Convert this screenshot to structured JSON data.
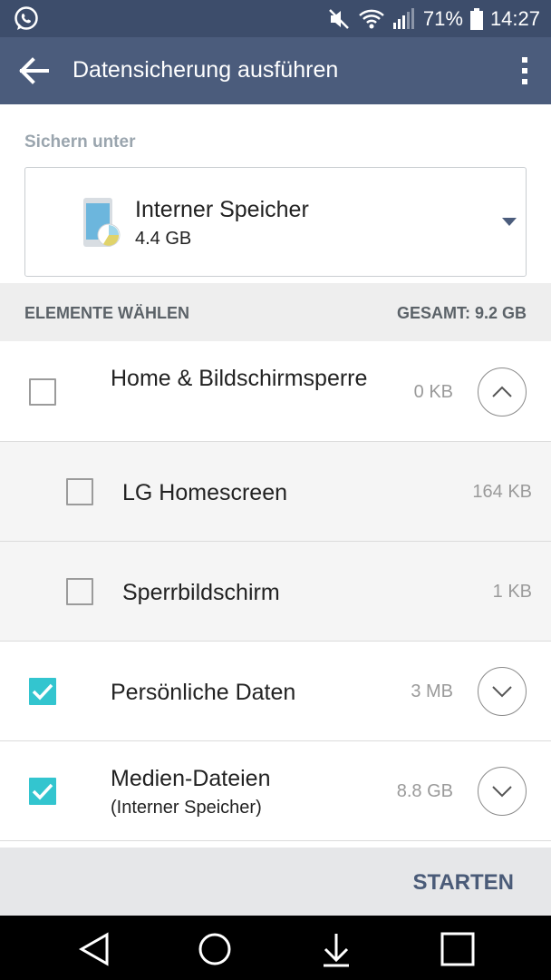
{
  "status_bar": {
    "battery": "71%",
    "time": "14:27",
    "icons": [
      "whatsapp-icon",
      "mute-icon",
      "wifi-icon",
      "signal-icon",
      "battery-icon"
    ]
  },
  "app_bar": {
    "title": "Datensicherung ausführen",
    "icons": [
      "back-arrow-icon",
      "overflow-menu-icon"
    ]
  },
  "save_location": {
    "label": "Sichern unter",
    "storage_name": "Interner Speicher",
    "storage_size": "4.4 GB",
    "icons": [
      "phone-storage-icon",
      "dropdown-caret-icon"
    ]
  },
  "section": {
    "label": "ELEMENTE WÄHLEN",
    "total": "GESAMT: 9.2 GB"
  },
  "items": [
    {
      "label": "Home & Bildschirmsperre",
      "size": "0 KB",
      "checked": false,
      "expand": "collapse"
    },
    {
      "label": "LG Homescreen",
      "size": "164 KB",
      "checked": false
    },
    {
      "label": "Sperrbildschirm",
      "size": "1 KB",
      "checked": false
    },
    {
      "label": "Persönliche Daten",
      "size": "3 MB",
      "checked": true,
      "expand": "expand"
    },
    {
      "label": "Medien-Dateien",
      "sublabel": "(Interner Speicher)",
      "size": "8.8 GB",
      "checked": true,
      "expand": "expand"
    }
  ],
  "footer": {
    "start_label": "STARTEN"
  },
  "colors": {
    "app_bar": "#4b5c7c",
    "status_bar": "#3d4d6b",
    "checkbox_checked": "#33c5cf",
    "start_text": "#4a5b78"
  }
}
